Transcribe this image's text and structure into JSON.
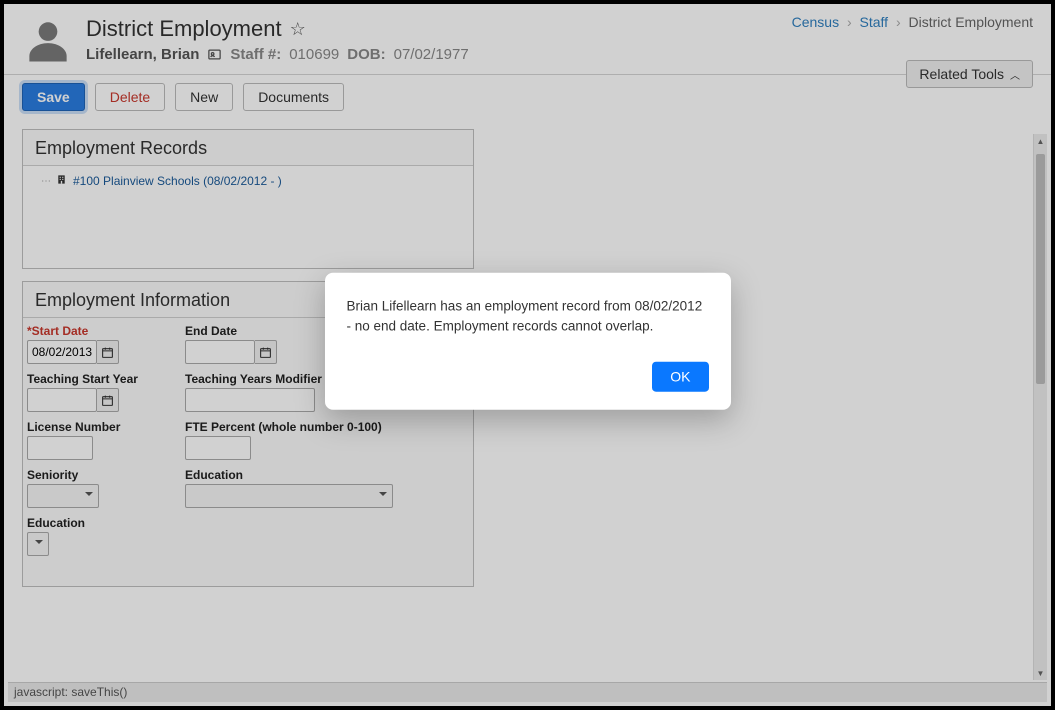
{
  "header": {
    "page_title": "District Employment",
    "person_name": "Lifellearn, Brian",
    "staff_label": "Staff #:",
    "staff_number": "010699",
    "dob_label": "DOB:",
    "dob_value": "07/02/1977"
  },
  "breadcrumb": {
    "items": [
      "Census",
      "Staff",
      "District Employment"
    ]
  },
  "related_tools_label": "Related Tools",
  "toolbar": {
    "save": "Save",
    "delete": "Delete",
    "new": "New",
    "documents": "Documents"
  },
  "panels": {
    "records_title": "Employment Records",
    "record_item": "#100 Plainview Schools (08/02/2012 - )",
    "info_title": "Employment Information"
  },
  "fields": {
    "start_date_label": "*Start Date",
    "start_date_value": "08/02/2013",
    "end_date_label": "End Date",
    "end_date_value": "",
    "teaching_start_year_label": "Teaching Start Year",
    "teaching_start_year_value": "",
    "teaching_years_modifier_label": "Teaching Years Modifier",
    "teaching_years_modifier_value": "",
    "license_number_label": "License Number",
    "license_number_value": "",
    "fte_percent_label": "FTE Percent (whole number 0-100)",
    "fte_percent_value": "",
    "seniority_label": "Seniority",
    "education_label": "Education",
    "education2_label": "Education"
  },
  "modal": {
    "message": "Brian Lifellearn has an employment record from 08/02/2012 - no end date. Employment records cannot overlap.",
    "ok": "OK"
  },
  "statusbar": "javascript: saveThis()"
}
